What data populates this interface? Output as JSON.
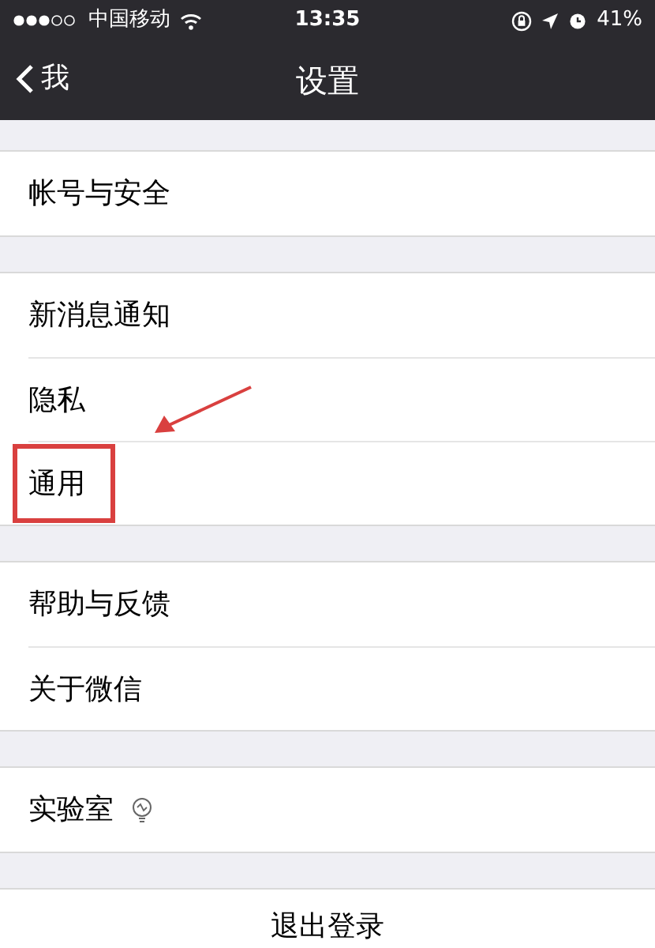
{
  "status_bar": {
    "carrier": "中国移动",
    "time": "13:35",
    "battery": "41%"
  },
  "nav_bar": {
    "back": "我",
    "title": "设置"
  },
  "groups": [
    {
      "items": [
        {
          "kind": "item",
          "label": "帐号与安全",
          "highlighted": false
        }
      ]
    },
    {
      "items": [
        {
          "kind": "item",
          "label": "新消息通知",
          "highlighted": false
        },
        {
          "kind": "item",
          "label": "隐私",
          "highlighted": false
        },
        {
          "kind": "item",
          "label": "通用",
          "highlighted": true
        }
      ]
    },
    {
      "items": [
        {
          "kind": "item",
          "label": "帮助与反馈",
          "highlighted": false
        },
        {
          "kind": "item",
          "label": "关于微信",
          "highlighted": false
        }
      ]
    },
    {
      "items": [
        {
          "kind": "item_with_icon",
          "label": "实验室",
          "highlighted": false
        }
      ]
    },
    {
      "items": [
        {
          "kind": "action",
          "label": "退出登录"
        }
      ]
    }
  ]
}
